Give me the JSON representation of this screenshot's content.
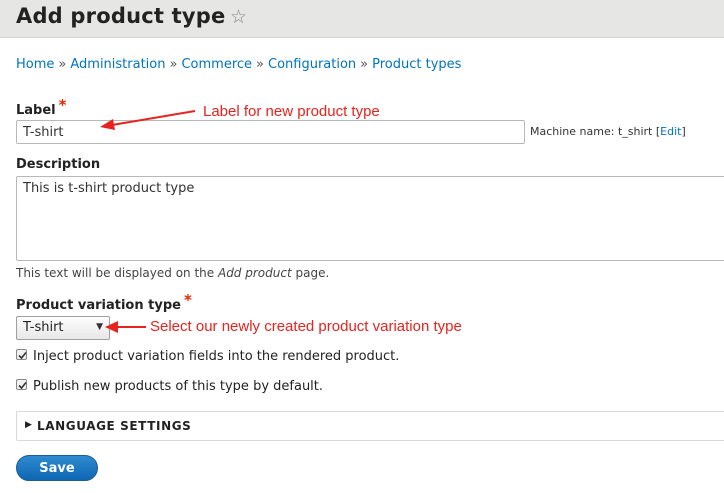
{
  "header": {
    "title": "Add product type",
    "star_icon": "star-outline-icon"
  },
  "breadcrumb": {
    "items": [
      "Home",
      "Administration",
      "Commerce",
      "Configuration",
      "Product types"
    ],
    "separator": "»"
  },
  "form": {
    "label": {
      "title": "Label",
      "required_mark": "*",
      "value": "T-shirt",
      "machine_name_prefix": "Machine name: t_shirt [",
      "machine_name_edit": "Edit",
      "machine_name_suffix": "]"
    },
    "description": {
      "title": "Description",
      "value": "This is t-shirt product type",
      "help_prefix": "This text will be displayed on the ",
      "help_em": "Add product",
      "help_suffix": " page."
    },
    "variation_type": {
      "title": "Product variation type",
      "required_mark": "*",
      "selected": "T-shirt"
    },
    "checkboxes": [
      {
        "label": "Inject product variation fields into the rendered product.",
        "checked": true
      },
      {
        "label": "Publish new products of this type by default.",
        "checked": true
      }
    ],
    "language_settings": {
      "label": "LANGUAGE SETTINGS",
      "expanded": false
    },
    "save_label": "Save"
  },
  "annotations": {
    "label_note": "Label for new product type",
    "variation_note": "Select our newly created product variation type",
    "color": "#e6231e"
  },
  "colors": {
    "link": "#0074bd",
    "required": "#e62600",
    "button": "#0d67b2",
    "header_bg": "#e6e6e4"
  }
}
